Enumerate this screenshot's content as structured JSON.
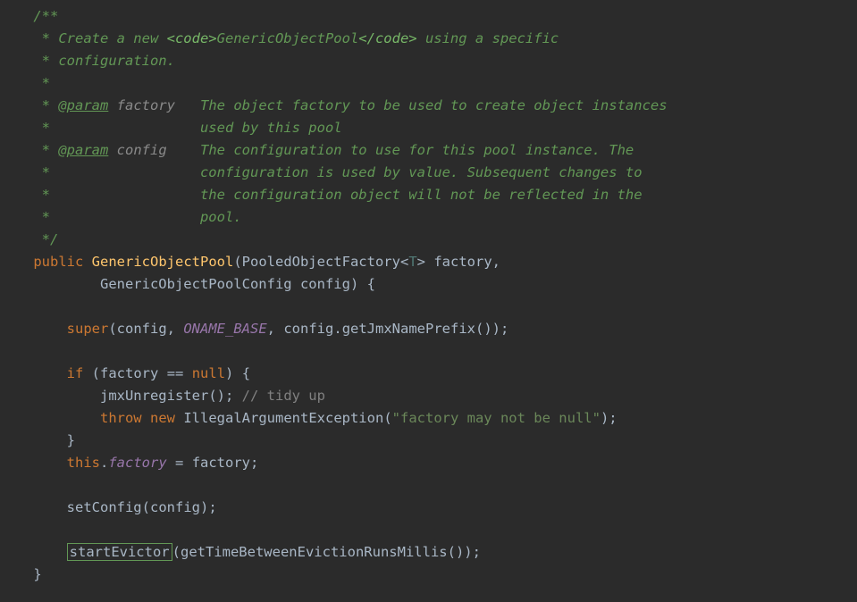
{
  "javadoc": {
    "open": "/**",
    "line1_a": " * Create a new ",
    "line1_code_open": "<code>",
    "line1_code_body": "GenericObjectPool",
    "line1_code_close": "</code>",
    "line1_b": " using a specific",
    "line2": " * configuration.",
    "blank": " *",
    "param_tag": "@param",
    "p1_name": "factory",
    "p1_l1": "The object factory to be used to create object instances",
    "p1_l2": "used by this pool",
    "p2_name": "config",
    "p2_l1": "The configuration to use for this pool instance. The",
    "p2_l2": "configuration is used by value. Subsequent changes to",
    "p2_l3": "the configuration object will not be reflected in the",
    "p2_l4": "pool.",
    "close": " */"
  },
  "sig": {
    "kw_public": "public",
    "ctor_name": "GenericObjectPool",
    "arg1_type": "PooledObjectFactory",
    "arg1_generic": "T",
    "arg1_name": "factory",
    "arg2_type": "GenericObjectPoolConfig",
    "arg2_name": "config"
  },
  "body": {
    "kw_super": "super",
    "super_arg1": "config",
    "super_const": "ONAME_BASE",
    "super_call2a": "config",
    "super_call2b": "getJmxNamePrefix",
    "kw_if": "if",
    "cond_var": "factory",
    "kw_null": "null",
    "jmx_call": "jmxUnregister",
    "cmt_tidy": "// tidy up",
    "kw_throw": "throw",
    "kw_new": "new",
    "exc_type": "IllegalArgumentException",
    "exc_msg": "\"factory may not be null\"",
    "kw_this": "this",
    "assign_field": "factory",
    "assign_rhs": "factory",
    "setconfig": "setConfig",
    "setconfig_arg": "config",
    "startevictor": "startEvictor",
    "gettb": "getTimeBetweenEvictionRunsMillis"
  }
}
